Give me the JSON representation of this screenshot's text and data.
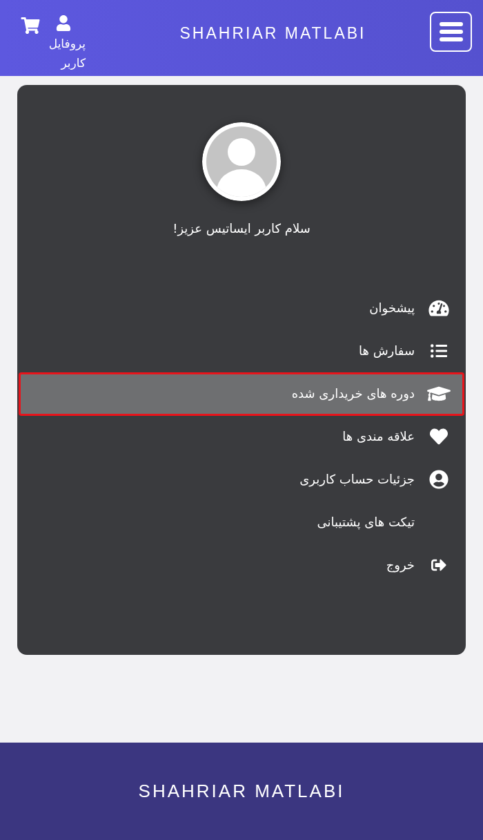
{
  "header": {
    "logo": "SHAHRIAR MATLABI",
    "profile_label": "پروفایل کاربر"
  },
  "profile": {
    "greeting": "سلام کاربر ایساتیس عزیز!"
  },
  "menu": [
    {
      "label": "پیشخوان",
      "kind": "dashboard",
      "selected": false,
      "outlined": false
    },
    {
      "label": "سفارش ها",
      "kind": "orders",
      "selected": false,
      "outlined": false
    },
    {
      "label": "دوره های خریداری شده",
      "kind": "courses",
      "selected": true,
      "outlined": true
    },
    {
      "label": "علاقه مندی ها",
      "kind": "favorites",
      "selected": false,
      "outlined": false
    },
    {
      "label": "جزئیات حساب کاربری",
      "kind": "account",
      "selected": false,
      "outlined": false
    },
    {
      "label": "تیکت های پشتیبانی",
      "kind": "tickets",
      "selected": false,
      "outlined": false
    },
    {
      "label": "خروج",
      "kind": "logout",
      "selected": false,
      "outlined": false
    }
  ],
  "footer": {
    "logo": "SHAHRIAR MATLABI"
  }
}
